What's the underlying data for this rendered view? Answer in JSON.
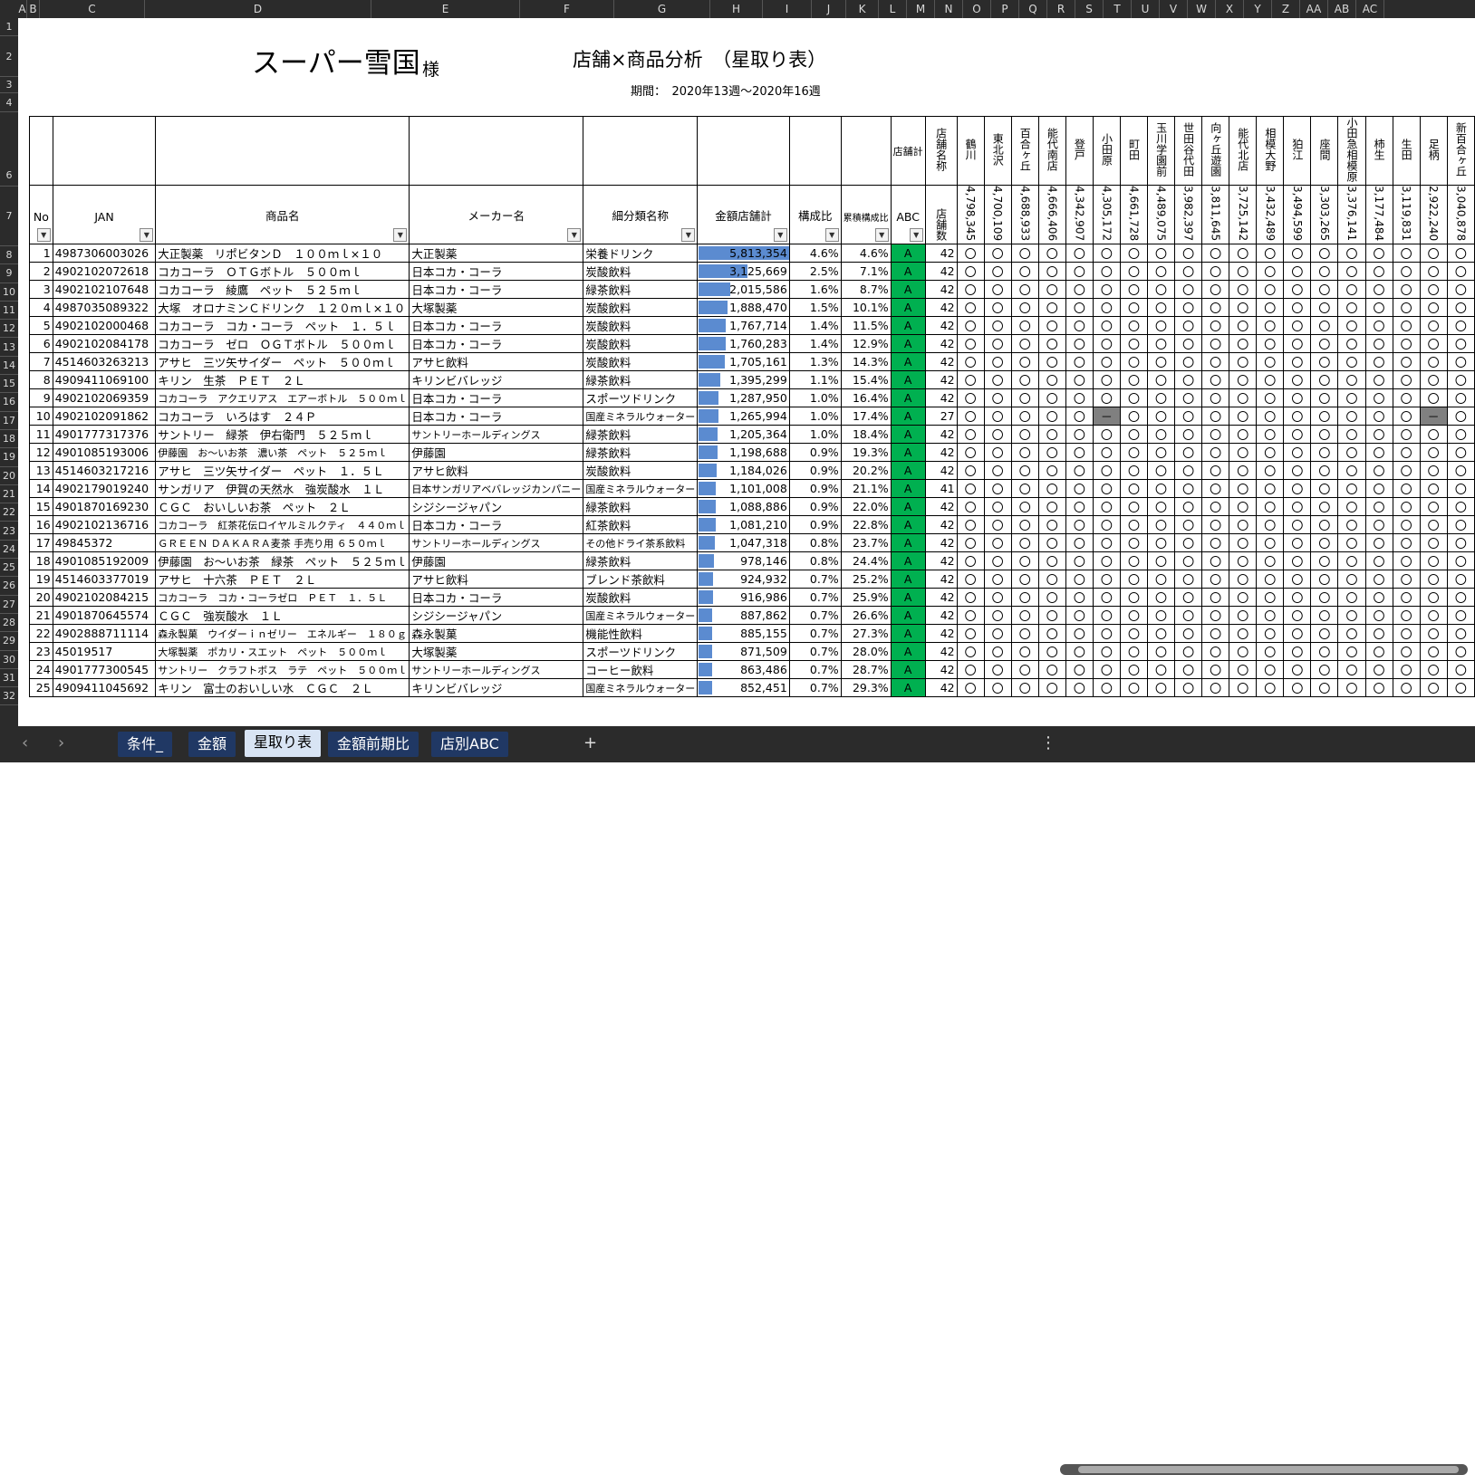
{
  "sheet": {
    "title": "スーパー雪国",
    "title_suffix": "様",
    "subtitle": "店舗×商品分析　（星取り表）",
    "period": "期間：　2020年13週～2020年16週"
  },
  "column_letters": [
    "A",
    "B",
    "C",
    "D",
    "E",
    "F",
    "G",
    "H",
    "I",
    "J",
    "K",
    "L",
    "M",
    "N",
    "O",
    "P",
    "Q",
    "R",
    "S",
    "T",
    "U",
    "V",
    "W",
    "X",
    "Y",
    "Z",
    "AA",
    "AB",
    "AC"
  ],
  "row_numbers": [
    "1",
    "2",
    "3",
    "4",
    "6",
    "7",
    "8",
    "9",
    "10",
    "11",
    "12",
    "13",
    "14",
    "15",
    "16",
    "17",
    "18",
    "19",
    "20",
    "21",
    "22",
    "23",
    "24",
    "25",
    "26",
    "27",
    "28",
    "29",
    "30",
    "31",
    "32"
  ],
  "headers": {
    "no": "No",
    "jan": "JAN",
    "product": "商品名",
    "maker": "メーカー名",
    "category": "細分類名称",
    "amount": "金額店舗計",
    "ratio": "構成比",
    "cum": "累積構成比",
    "abc": "ABC",
    "store_total": "店舗計",
    "store_name": "店舗名称",
    "store_count": "店舗数"
  },
  "stores": [
    {
      "name": "鶴川",
      "amount": "4,798,345"
    },
    {
      "name": "東北沢",
      "amount": "4,700,109"
    },
    {
      "name": "百合ヶ丘",
      "amount": "4,688,933"
    },
    {
      "name": "能代南店",
      "amount": "4,666,406"
    },
    {
      "name": "登戸",
      "amount": "4,342,907"
    },
    {
      "name": "小田原",
      "amount": "4,305,172"
    },
    {
      "name": "町田",
      "amount": "4,661,728"
    },
    {
      "name": "玉川学園前",
      "amount": "4,489,075"
    },
    {
      "name": "世田谷代田",
      "amount": "3,982,397"
    },
    {
      "name": "向ヶ丘遊園",
      "amount": "3,811,645"
    },
    {
      "name": "能代北店",
      "amount": "3,725,142"
    },
    {
      "name": "相模大野",
      "amount": "3,432,489"
    },
    {
      "name": "狛江",
      "amount": "3,494,599"
    },
    {
      "name": "座間",
      "amount": "3,303,265"
    },
    {
      "name": "小田急相模原",
      "amount": "3,376,141"
    },
    {
      "name": "柿生",
      "amount": "3,177,484"
    },
    {
      "name": "生田",
      "amount": "3,119,831"
    },
    {
      "name": "足柄",
      "amount": "2,922,240"
    },
    {
      "name": "新百合ヶ丘",
      "amount": "3,040,878"
    }
  ],
  "products": [
    {
      "no": "1",
      "jan": "4987306003026",
      "name": "大正製薬　リポビタンＤ　１００ｍｌ×１０",
      "maker": "大正製薬",
      "cat": "栄養ドリンク",
      "amount": "5,813,354",
      "ratio": "4.6%",
      "cum": "4.6%",
      "abc": "A",
      "stores": "42",
      "bar": 1.0
    },
    {
      "no": "2",
      "jan": "4902102072618",
      "name": "コカコーラ　ＯＴＧボトル　５００ｍｌ",
      "maker": "日本コカ・コーラ",
      "cat": "炭酸飲料",
      "amount": "3,125,669",
      "ratio": "2.5%",
      "cum": "7.1%",
      "abc": "A",
      "stores": "42",
      "bar": 0.54
    },
    {
      "no": "3",
      "jan": "4902102107648",
      "name": "コカコーラ　綾鷹　ペット　５２５ｍｌ",
      "maker": "日本コカ・コーラ",
      "cat": "緑茶飲料",
      "amount": "2,015,586",
      "ratio": "1.6%",
      "cum": "8.7%",
      "abc": "A",
      "stores": "42",
      "bar": 0.35
    },
    {
      "no": "4",
      "jan": "4987035089322",
      "name": "大塚　オロナミンＣドリンク　１２０ｍｌ×１０",
      "maker": "大塚製薬",
      "cat": "炭酸飲料",
      "amount": "1,888,470",
      "ratio": "1.5%",
      "cum": "10.1%",
      "abc": "A",
      "stores": "42",
      "bar": 0.32
    },
    {
      "no": "5",
      "jan": "4902102000468",
      "name": "コカコーラ　コカ・コーラ　ペット　１．５ｌ",
      "maker": "日本コカ・コーラ",
      "cat": "炭酸飲料",
      "amount": "1,767,714",
      "ratio": "1.4%",
      "cum": "11.5%",
      "abc": "A",
      "stores": "42",
      "bar": 0.3
    },
    {
      "no": "6",
      "jan": "4902102084178",
      "name": "コカコーラ　ゼロ　ＯＧＴボトル　５００ｍｌ",
      "maker": "日本コカ・コーラ",
      "cat": "炭酸飲料",
      "amount": "1,760,283",
      "ratio": "1.4%",
      "cum": "12.9%",
      "abc": "A",
      "stores": "42",
      "bar": 0.3
    },
    {
      "no": "7",
      "jan": "4514603263213",
      "name": "アサヒ　三ツ矢サイダー　ペット　５００ｍｌ",
      "maker": "アサヒ飲料",
      "cat": "炭酸飲料",
      "amount": "1,705,161",
      "ratio": "1.3%",
      "cum": "14.3%",
      "abc": "A",
      "stores": "42",
      "bar": 0.29
    },
    {
      "no": "8",
      "jan": "4909411069100",
      "name": "キリン　生茶　ＰＥＴ　２Ｌ",
      "maker": "キリンビバレッジ",
      "cat": "緑茶飲料",
      "amount": "1,395,299",
      "ratio": "1.1%",
      "cum": "15.4%",
      "abc": "A",
      "stores": "42",
      "bar": 0.24
    },
    {
      "no": "9",
      "jan": "4902102069359",
      "name": "コカコーラ　アクエリアス　エアーボトル　５００ｍｌ",
      "maker": "日本コカ・コーラ",
      "cat": "スポーツドリンク",
      "amount": "1,287,950",
      "ratio": "1.0%",
      "cum": "16.4%",
      "abc": "A",
      "stores": "42",
      "bar": 0.22
    },
    {
      "no": "10",
      "jan": "4902102091862",
      "name": "コカコーラ　いろはす　２４Ｐ",
      "maker": "日本コカ・コーラ",
      "cat": "国産ミネラルウォーター",
      "amount": "1,265,994",
      "ratio": "1.0%",
      "cum": "17.4%",
      "abc": "A",
      "stores": "27",
      "bar": 0.22,
      "missing": [
        5,
        17
      ]
    },
    {
      "no": "11",
      "jan": "4901777317376",
      "name": "サントリー　緑茶　伊右衛門　５２５ｍｌ",
      "maker": "サントリーホールディングス",
      "cat": "緑茶飲料",
      "amount": "1,205,364",
      "ratio": "1.0%",
      "cum": "18.4%",
      "abc": "A",
      "stores": "42",
      "bar": 0.21
    },
    {
      "no": "12",
      "jan": "4901085193006",
      "name": "伊藤園　お～いお茶　濃い茶　ペット　５２５ｍｌ",
      "maker": "伊藤園",
      "cat": "緑茶飲料",
      "amount": "1,198,688",
      "ratio": "0.9%",
      "cum": "19.3%",
      "abc": "A",
      "stores": "42",
      "bar": 0.21
    },
    {
      "no": "13",
      "jan": "4514603217216",
      "name": "アサヒ　三ツ矢サイダー　ペット　１．５Ｌ",
      "maker": "アサヒ飲料",
      "cat": "炭酸飲料",
      "amount": "1,184,026",
      "ratio": "0.9%",
      "cum": "20.2%",
      "abc": "A",
      "stores": "42",
      "bar": 0.2
    },
    {
      "no": "14",
      "jan": "4902179019240",
      "name": "サンガリア　伊賀の天然水　強炭酸水　１Ｌ",
      "maker": "日本サンガリアベバレッジカンパニー",
      "cat": "国産ミネラルウォーター",
      "amount": "1,101,008",
      "ratio": "0.9%",
      "cum": "21.1%",
      "abc": "A",
      "stores": "41",
      "bar": 0.19
    },
    {
      "no": "15",
      "jan": "4901870169230",
      "name": "ＣＧＣ　おいしいお茶　ペット　２Ｌ",
      "maker": "シジシージャパン",
      "cat": "緑茶飲料",
      "amount": "1,088,886",
      "ratio": "0.9%",
      "cum": "22.0%",
      "abc": "A",
      "stores": "42",
      "bar": 0.19
    },
    {
      "no": "16",
      "jan": "4902102136716",
      "name": "コカコーラ　紅茶花伝ロイヤルミルクティ　４４０ｍｌ",
      "maker": "日本コカ・コーラ",
      "cat": "紅茶飲料",
      "amount": "1,081,210",
      "ratio": "0.9%",
      "cum": "22.8%",
      "abc": "A",
      "stores": "42",
      "bar": 0.19
    },
    {
      "no": "17",
      "jan": "49845372",
      "name": "ＧＲＥＥＮ ＤＡＫＡＲＡ麦茶 手売り用 ６５０ｍｌ",
      "maker": "サントリーホールディングス",
      "cat": "その他ドライ茶系飲料",
      "amount": "1,047,318",
      "ratio": "0.8%",
      "cum": "23.7%",
      "abc": "A",
      "stores": "42",
      "bar": 0.18
    },
    {
      "no": "18",
      "jan": "4901085192009",
      "name": "伊藤園　お～いお茶　緑茶　ペット　５２５ｍｌ",
      "maker": "伊藤園",
      "cat": "緑茶飲料",
      "amount": "978,146",
      "ratio": "0.8%",
      "cum": "24.4%",
      "abc": "A",
      "stores": "42",
      "bar": 0.17
    },
    {
      "no": "19",
      "jan": "4514603377019",
      "name": "アサヒ　十六茶　ＰＥＴ　２Ｌ",
      "maker": "アサヒ飲料",
      "cat": "ブレンド茶飲料",
      "amount": "924,932",
      "ratio": "0.7%",
      "cum": "25.2%",
      "abc": "A",
      "stores": "42",
      "bar": 0.16
    },
    {
      "no": "20",
      "jan": "4902102084215",
      "name": "コカコーラ　コカ・コーラゼロ　ＰＥＴ　１．５Ｌ",
      "maker": "日本コカ・コーラ",
      "cat": "炭酸飲料",
      "amount": "916,986",
      "ratio": "0.7%",
      "cum": "25.9%",
      "abc": "A",
      "stores": "42",
      "bar": 0.16
    },
    {
      "no": "21",
      "jan": "4901870645574",
      "name": "ＣＧＣ　強炭酸水　１Ｌ",
      "maker": "シジシージャパン",
      "cat": "国産ミネラルウォーター",
      "amount": "887,862",
      "ratio": "0.7%",
      "cum": "26.6%",
      "abc": "A",
      "stores": "42",
      "bar": 0.15
    },
    {
      "no": "22",
      "jan": "4902888711114",
      "name": "森永製菓　ウイダーｉｎゼリー　エネルギー　１８０ｇ",
      "maker": "森永製菓",
      "cat": "機能性飲料",
      "amount": "885,155",
      "ratio": "0.7%",
      "cum": "27.3%",
      "abc": "A",
      "stores": "42",
      "bar": 0.15
    },
    {
      "no": "23",
      "jan": "45019517",
      "name": "大塚製薬　ポカリ・スエット　ペット　５００ｍｌ",
      "maker": "大塚製薬",
      "cat": "スポーツドリンク",
      "amount": "871,509",
      "ratio": "0.7%",
      "cum": "28.0%",
      "abc": "A",
      "stores": "42",
      "bar": 0.15
    },
    {
      "no": "24",
      "jan": "4901777300545",
      "name": "サントリー　クラフトボス　ラテ　ペット　５００ｍｌ",
      "maker": "サントリーホールディングス",
      "cat": "コーヒー飲料",
      "amount": "863,486",
      "ratio": "0.7%",
      "cum": "28.7%",
      "abc": "A",
      "stores": "42",
      "bar": 0.15
    },
    {
      "no": "25",
      "jan": "4909411045692",
      "name": "キリン　富士のおいしい水　ＣＧＣ　２Ｌ",
      "maker": "キリンビバレッジ",
      "cat": "国産ミネラルウォーター",
      "amount": "852,451",
      "ratio": "0.7%",
      "cum": "29.3%",
      "abc": "A",
      "stores": "42",
      "bar": 0.15
    }
  ],
  "marks": {
    "present": "〇",
    "absent": "－"
  },
  "tabs": [
    "条件_",
    "金額",
    "星取り表",
    "金額前期比",
    "店別ABC"
  ],
  "active_tab": 2,
  "add_sheet": "+",
  "colors": {
    "abc_green": "#00b050",
    "bar_blue": "#5b8bd0",
    "tab_bg": "#203864",
    "missing_gray": "#808080"
  }
}
